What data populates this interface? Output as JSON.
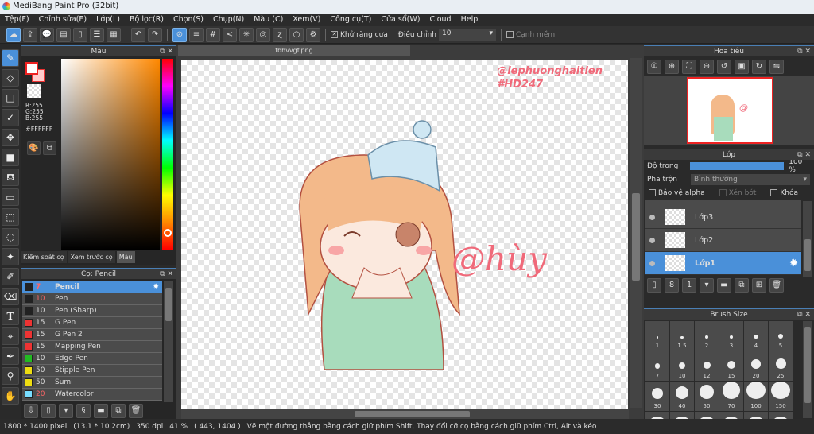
{
  "title": "MediBang Paint Pro (32bit)",
  "menu": [
    "Tệp(F)",
    "Chỉnh sửa(E)",
    "Lớp(L)",
    "Bộ lọc(R)",
    "Chọn(S)",
    "Chụp(N)",
    "Màu (C)",
    "Xem(V)",
    "Công cụ(T)",
    "Cửa sổ(W)",
    "Cloud",
    "Help"
  ],
  "toolbar": {
    "antialias_label": "Khử răng cưa",
    "correction_label": "Điều chỉnh",
    "correction_value": "10",
    "smooth_label": "Cạnh mềm",
    "antialias_checked": true,
    "smooth_checked": false
  },
  "color_panel": {
    "title": "Màu",
    "r": "R:255",
    "g": "G:255",
    "b": "B:255",
    "hex": "#FFFFFF",
    "tabs": [
      "Kiểm soát cọ",
      "Xem trước cọ",
      "Màu"
    ],
    "active_tab": "Màu",
    "hue_color": "#ff8800"
  },
  "brush_panel": {
    "title": "Cọ: Pencil",
    "items": [
      {
        "size": "7",
        "name": "Pencil",
        "color": "#222222",
        "size_red": true,
        "selected": true
      },
      {
        "size": "10",
        "name": "Pen",
        "color": "#222222",
        "size_red": true
      },
      {
        "size": "10",
        "name": "Pen (Sharp)",
        "color": "#222222"
      },
      {
        "size": "15",
        "name": "G Pen",
        "color": "#ee3333"
      },
      {
        "size": "15",
        "name": "G Pen 2",
        "color": "#ee3333"
      },
      {
        "size": "15",
        "name": "Mapping Pen",
        "color": "#ee3333"
      },
      {
        "size": "10",
        "name": "Edge Pen",
        "color": "#22bb22"
      },
      {
        "size": "50",
        "name": "Stipple Pen",
        "color": "#eedd11"
      },
      {
        "size": "50",
        "name": "Sumi",
        "color": "#eedd11"
      },
      {
        "size": "20",
        "name": "Watercolor",
        "color": "#77ddff",
        "size_red": true
      }
    ]
  },
  "document": {
    "tab": "fbhvvgf.png",
    "watermark_line1": "@lephuonghaitien",
    "watermark_line2": "#HD247",
    "signature": "@hùy"
  },
  "navigator": {
    "title": "Hoa tiêu"
  },
  "layer_panel": {
    "title": "Lớp",
    "opacity_label": "Độ trong",
    "opacity_value": "100 %",
    "opacity": 100,
    "blend_label": "Pha trộn",
    "blend_value": "Bình thường",
    "protect_alpha": "Bảo vệ alpha",
    "clipping": "Xén bớt",
    "lock": "Khóa",
    "layers": [
      {
        "name": "Lớp3"
      },
      {
        "name": "Lớp2"
      },
      {
        "name": "Lớp1",
        "selected": true
      }
    ]
  },
  "brush_size": {
    "title": "Brush Size",
    "sizes": [
      "1",
      "1.5",
      "2",
      "3",
      "4",
      "5",
      "7",
      "10",
      "12",
      "15",
      "20",
      "25",
      "30",
      "40",
      "50",
      "70",
      "100",
      "150"
    ]
  },
  "status": {
    "dimensions": "1800 * 1400 pixel",
    "physical": "(13.1 * 10.2cm)",
    "dpi": "350 dpi",
    "zoom": "41 %",
    "coords": "( 443, 1404 )",
    "hint": "Vẽ một đường thẳng bằng cách giữ phím Shift, Thay đổi cỡ cọ bằng cách giữ phím Ctrl, Alt và kéo"
  },
  "colors": {
    "accent": "#4a90d9",
    "watermark": "#f06a7a"
  }
}
